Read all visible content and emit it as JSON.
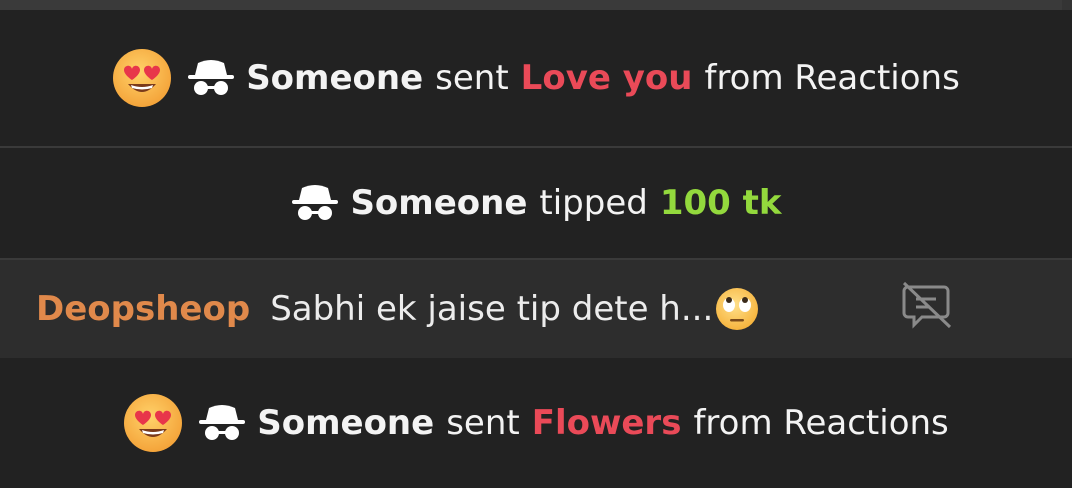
{
  "events": [
    {
      "user": "Someone",
      "verb": "sent",
      "item": "Love you",
      "tail": "from Reactions",
      "icon": "heart-eyes-emoji-icon",
      "item_color": "#ea4a58"
    },
    {
      "user": "Someone",
      "verb": "tipped",
      "amount": "100 tk",
      "amount_color": "#93d93d"
    },
    {
      "user": "Someone",
      "verb": "sent",
      "item": "Flowers",
      "tail": "from Reactions",
      "icon": "heart-eyes-emoji-icon",
      "item_color": "#ea4a58"
    }
  ],
  "chat": {
    "username": "Deopsheop",
    "message": "Sabhi ek jaise tip dete h...",
    "message_emoji": "eye-roll-emoji-icon",
    "action_icon": "hide-message-icon",
    "username_color": "#e0894b"
  },
  "colors": {
    "background": "#222222",
    "chat_row_bg": "#2d2d2d",
    "divider": "#3a3a3a"
  }
}
